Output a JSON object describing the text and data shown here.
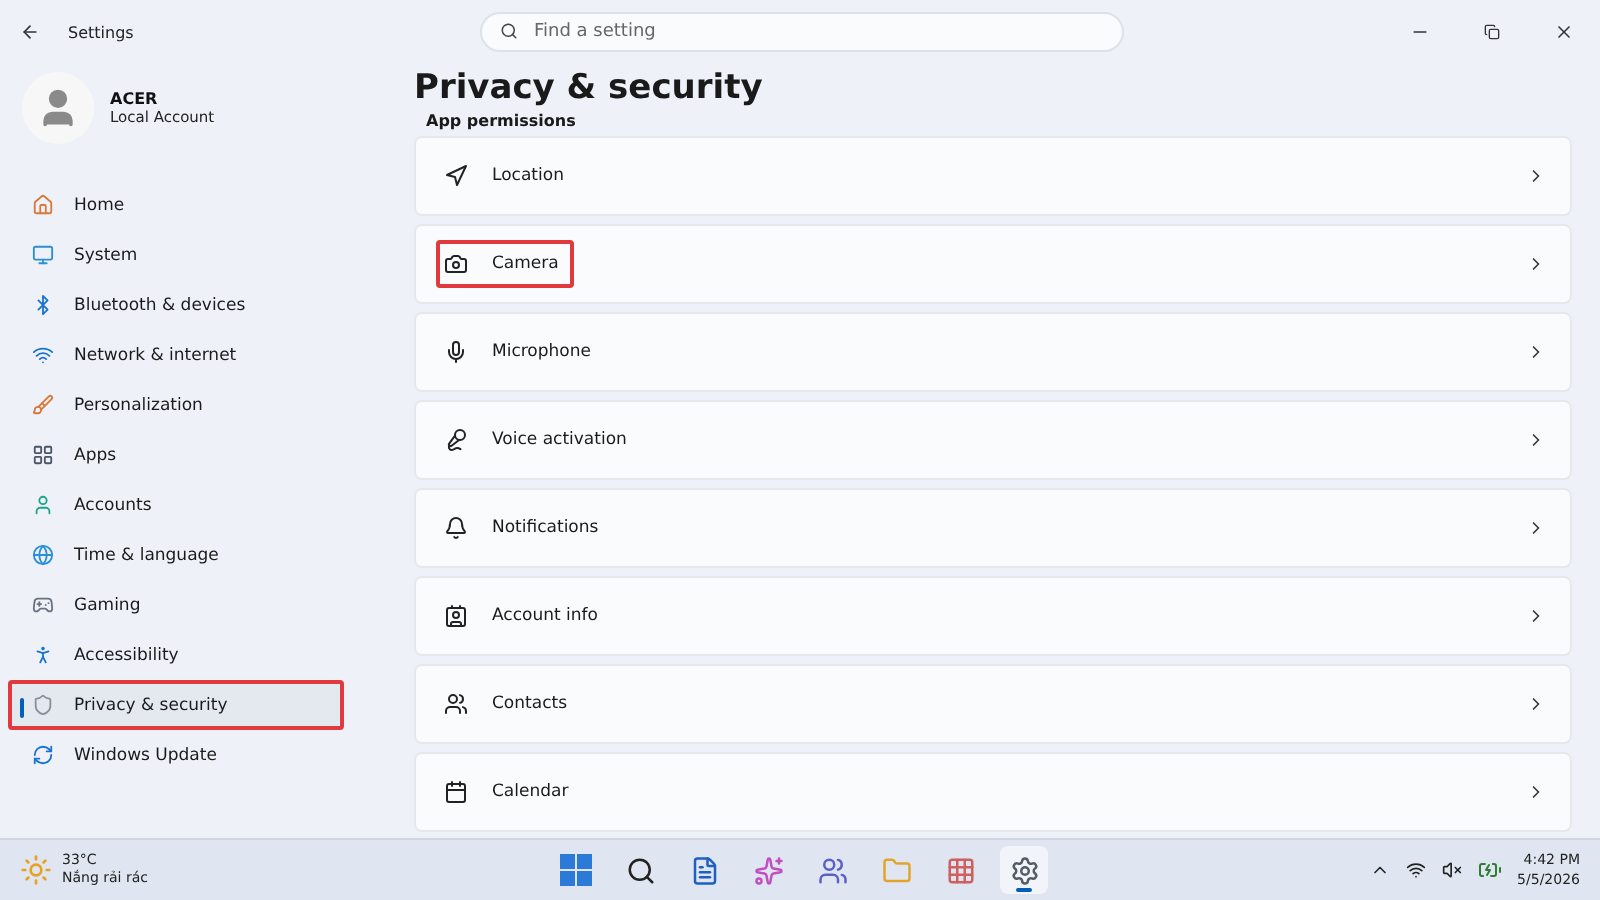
{
  "window": {
    "title": "Settings"
  },
  "search": {
    "placeholder": "Find a setting"
  },
  "account": {
    "name": "ACER",
    "type": "Local Account"
  },
  "sidebar": {
    "items": [
      {
        "label": "Home",
        "selected": false,
        "highlighted": false
      },
      {
        "label": "System",
        "selected": false,
        "highlighted": false
      },
      {
        "label": "Bluetooth & devices",
        "selected": false,
        "highlighted": false
      },
      {
        "label": "Network & internet",
        "selected": false,
        "highlighted": false
      },
      {
        "label": "Personalization",
        "selected": false,
        "highlighted": false
      },
      {
        "label": "Apps",
        "selected": false,
        "highlighted": false
      },
      {
        "label": "Accounts",
        "selected": false,
        "highlighted": false
      },
      {
        "label": "Time & language",
        "selected": false,
        "highlighted": false
      },
      {
        "label": "Gaming",
        "selected": false,
        "highlighted": false
      },
      {
        "label": "Accessibility",
        "selected": false,
        "highlighted": false
      },
      {
        "label": "Privacy & security",
        "selected": true,
        "highlighted": true
      },
      {
        "label": "Windows Update",
        "selected": false,
        "highlighted": false
      }
    ]
  },
  "page": {
    "title": "Privacy & security",
    "section": "App permissions",
    "items": [
      {
        "label": "Location",
        "highlighted": false
      },
      {
        "label": "Camera",
        "highlighted": true
      },
      {
        "label": "Microphone",
        "highlighted": false
      },
      {
        "label": "Voice activation",
        "highlighted": false
      },
      {
        "label": "Notifications",
        "highlighted": false
      },
      {
        "label": "Account info",
        "highlighted": false
      },
      {
        "label": "Contacts",
        "highlighted": false
      },
      {
        "label": "Calendar",
        "highlighted": false
      }
    ]
  },
  "taskbar": {
    "weather": {
      "temp": "33°C",
      "condition": "Nắng rải rác"
    },
    "apps": [
      {
        "selected": false
      },
      {
        "selected": false
      },
      {
        "selected": false
      },
      {
        "selected": false
      },
      {
        "selected": false
      },
      {
        "selected": false
      },
      {
        "selected": false
      },
      {
        "selected": true
      }
    ],
    "time": "4:42 PM",
    "date": "5/5/2026"
  }
}
